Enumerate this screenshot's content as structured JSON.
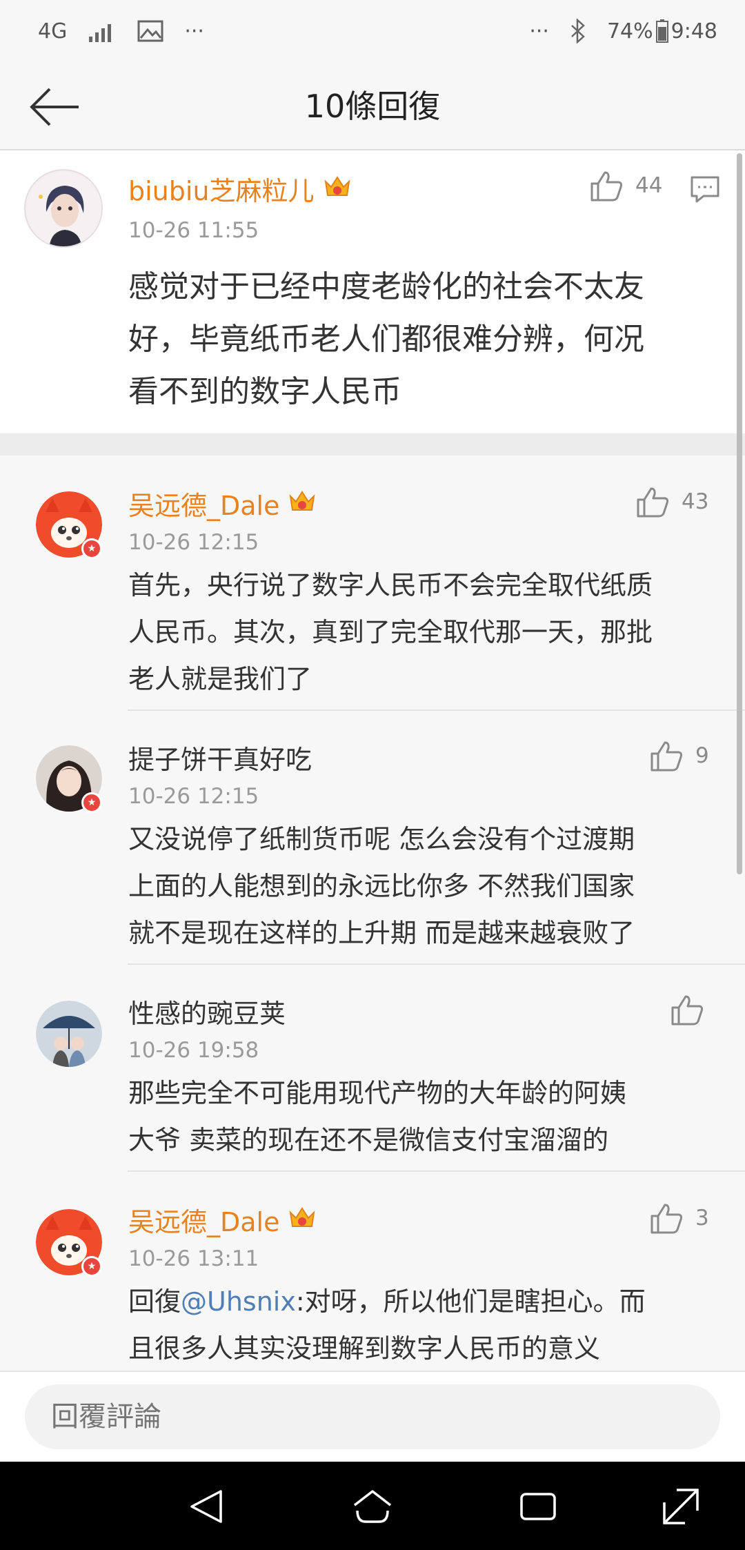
{
  "status_bar": {
    "network": "4G",
    "dots_left": "···",
    "dots_right": "···",
    "battery": "74%",
    "time": "9:48"
  },
  "header": {
    "title": "10條回復"
  },
  "main_comment": {
    "username": "biubiu芝麻粒儿",
    "timestamp": "10-26 11:55",
    "likes": "44",
    "text_lines": [
      "感觉对于已经中度老龄化的社会不太友",
      "好，毕竟纸币老人们都很难分辨，何况",
      "看不到的数字人民币"
    ]
  },
  "replies": [
    {
      "username": "吴远德_Dale",
      "timestamp": "10-26 12:15",
      "likes": "43",
      "text_lines": [
        "首先，央行说了数字人民币不会完全取代纸质",
        "人民币。其次，真到了完全取代那一天，那批",
        "老人就是我们了"
      ]
    },
    {
      "username": "提子饼干真好吃",
      "timestamp": "10-26 12:15",
      "likes": "9",
      "text_lines": [
        "又没说停了纸制货币呢 怎么会没有个过渡期",
        "上面的人能想到的永远比你多 不然我们国家",
        "就不是现在这样的上升期 而是越来越衰败了"
      ]
    },
    {
      "username": "性感的豌豆荚",
      "timestamp": "10-26 19:58",
      "likes": "",
      "text_lines": [
        "那些完全不可能用现代产物的大年龄的阿姨",
        "大爷 卖菜的现在还不是微信支付宝溜溜的"
      ]
    },
    {
      "username": "吴远德_Dale",
      "timestamp": "10-26 13:11",
      "likes": "3",
      "reply_prefix": "回復",
      "mention": "@Uhsnix",
      "line1_rest": ":对呀，所以他们是瞎担心。而",
      "line2": "且很多人其实没理解到数字人民币的意义"
    }
  ],
  "reply_bar": {
    "placeholder": "回覆評論"
  },
  "colors": {
    "username_vip": "#e8821f",
    "mention": "#4e7eb5",
    "badge": "#e9453f"
  }
}
